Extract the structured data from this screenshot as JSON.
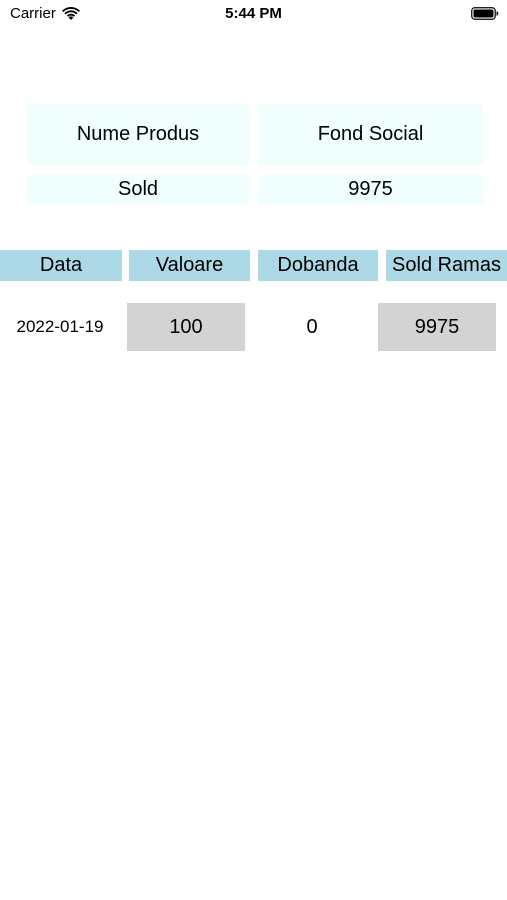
{
  "status_bar": {
    "carrier": "Carrier",
    "time": "5:44 PM",
    "wifi_icon": "wifi-icon",
    "battery_icon": "battery-icon"
  },
  "summary": {
    "product_label": "Nume Produs",
    "product_value": "Fond Social",
    "balance_label": "Sold",
    "balance_value": "9975"
  },
  "table": {
    "columns": [
      "Data",
      "Valoare",
      "Dobanda",
      "Sold Ramas"
    ],
    "rows": [
      {
        "date": "2022-01-19",
        "value": "100",
        "interest": "0",
        "remaining": "9975"
      }
    ]
  },
  "colors": {
    "summary_bg": "#f0fefe",
    "header_bg": "#add8e6",
    "value_box_bg": "#d3d3d3"
  }
}
